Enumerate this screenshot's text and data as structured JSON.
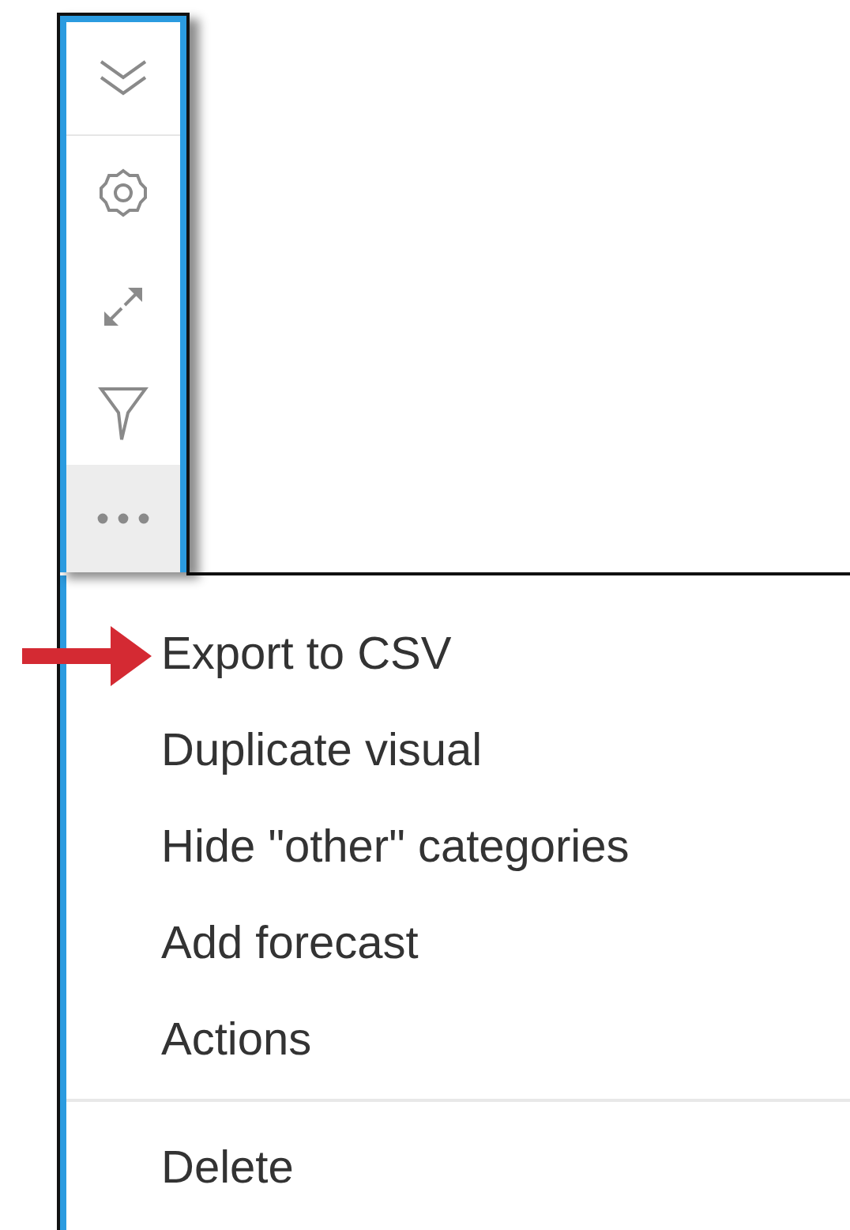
{
  "toolbar": {
    "buttons": [
      {
        "kind": "collapse",
        "selected": false
      },
      {
        "kind": "settings",
        "selected": false
      },
      {
        "kind": "expand",
        "selected": false
      },
      {
        "kind": "filter",
        "selected": false
      },
      {
        "kind": "more",
        "selected": true
      }
    ]
  },
  "menu": {
    "sections": [
      {
        "items": [
          {
            "label": "Export to CSV",
            "pointed": true
          },
          {
            "label": "Duplicate visual",
            "pointed": false
          },
          {
            "label": "Hide \"other\" categories",
            "pointed": false
          },
          {
            "label": "Add forecast",
            "pointed": false
          },
          {
            "label": "Actions",
            "pointed": false
          }
        ]
      },
      {
        "items": [
          {
            "label": "Delete",
            "pointed": false
          }
        ]
      }
    ]
  }
}
